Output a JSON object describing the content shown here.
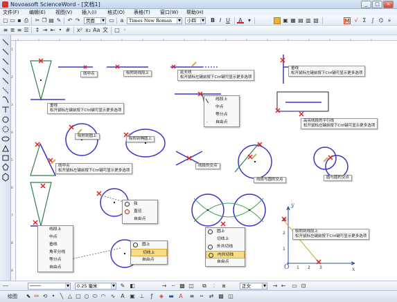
{
  "window": {
    "title": "Novoasoft ScienceWord - [文档1]",
    "buttons": [
      "_",
      "□",
      "×"
    ]
  },
  "menu": [
    "文件(F)",
    "编辑(E)",
    "视图(V)",
    "插入(I)",
    "格式(O)",
    "表格(T)",
    "窗口(W)",
    "帮助(H)"
  ],
  "toolbar1": {
    "style_combo": "页面",
    "font_combo": "Times New Roman",
    "size_combo": "小四",
    "bold": "B",
    "italic": "I",
    "underline": "U",
    "font_color": "A",
    "math_button": "M"
  },
  "bottom_toolbar": {
    "line_width": "0.25 毫米",
    "text_style": "正文",
    "draw_label": "绘图"
  },
  "canvas": {
    "tips": [
      {
        "id": "midpoint",
        "text": "线中点"
      },
      {
        "id": "to-segment",
        "text": "吸附到线段上"
      },
      {
        "id": "extension",
        "lines": [
          "延长线",
          "松开鼠标左键前按下Ctrl键可显示更多选项"
        ]
      },
      {
        "id": "perpendicular",
        "lines": [
          "垂线",
          "松开鼠标左键前按下Ctrl键可显示更多选项"
        ]
      },
      {
        "id": "altitude",
        "lines": [
          "垂线",
          "松开鼠标左键前按下Ctrl键可显示更多选项"
        ]
      },
      {
        "id": "to-circle",
        "text": "吸附到圆上"
      },
      {
        "id": "to-ellipse",
        "text": "吸附到椭圆上"
      },
      {
        "id": "parallel",
        "lines": [
          "高亮线段的平行线",
          "松开鼠标左键前按下Ctrl键可显示更多选项"
        ]
      },
      {
        "id": "midpoint-more",
        "lines": [
          "线中点",
          "松开鼠标左键前按下Ctrl键可显示更多选项"
        ]
      },
      {
        "id": "segments-intersect",
        "text": "线段的交点"
      },
      {
        "id": "seg-circle-intersect",
        "text": "线段与圆的交点"
      },
      {
        "id": "circle-circle-intersect",
        "text": "圆与圆的交点"
      },
      {
        "id": "to-segment-more",
        "lines": [
          "吸附到线段上",
          "松开鼠标左键前按下Ctrl键可显示更多选项"
        ]
      }
    ],
    "menus": {
      "segment_menu": [
        "线段上",
        "中点",
        "等分点",
        "自由点"
      ],
      "circle_center_menu": [
        "弦",
        "直径",
        "自由点"
      ],
      "left_menu": [
        "线段上",
        "中点",
        "垂线",
        "角平分线",
        "等分点",
        "自由点"
      ],
      "tangent_menu": [
        "圆上",
        "切线上",
        "自由点"
      ],
      "common_tangent_menu": [
        "圆上",
        "切线上",
        "外共切线",
        "内共切线",
        "自由点"
      ]
    },
    "axis": {
      "x_label": "x",
      "y_label": "y",
      "origin": "O",
      "x_ticks": [
        "1",
        "2",
        "3"
      ],
      "y_ticks": [
        "1",
        "2",
        "3"
      ]
    }
  },
  "colors": {
    "snap_marker": "#e02020",
    "segment": "#3b35c9",
    "triangle": "#2f7d4a",
    "highlight": "#d2b040",
    "green_curve": "#3aa257"
  }
}
